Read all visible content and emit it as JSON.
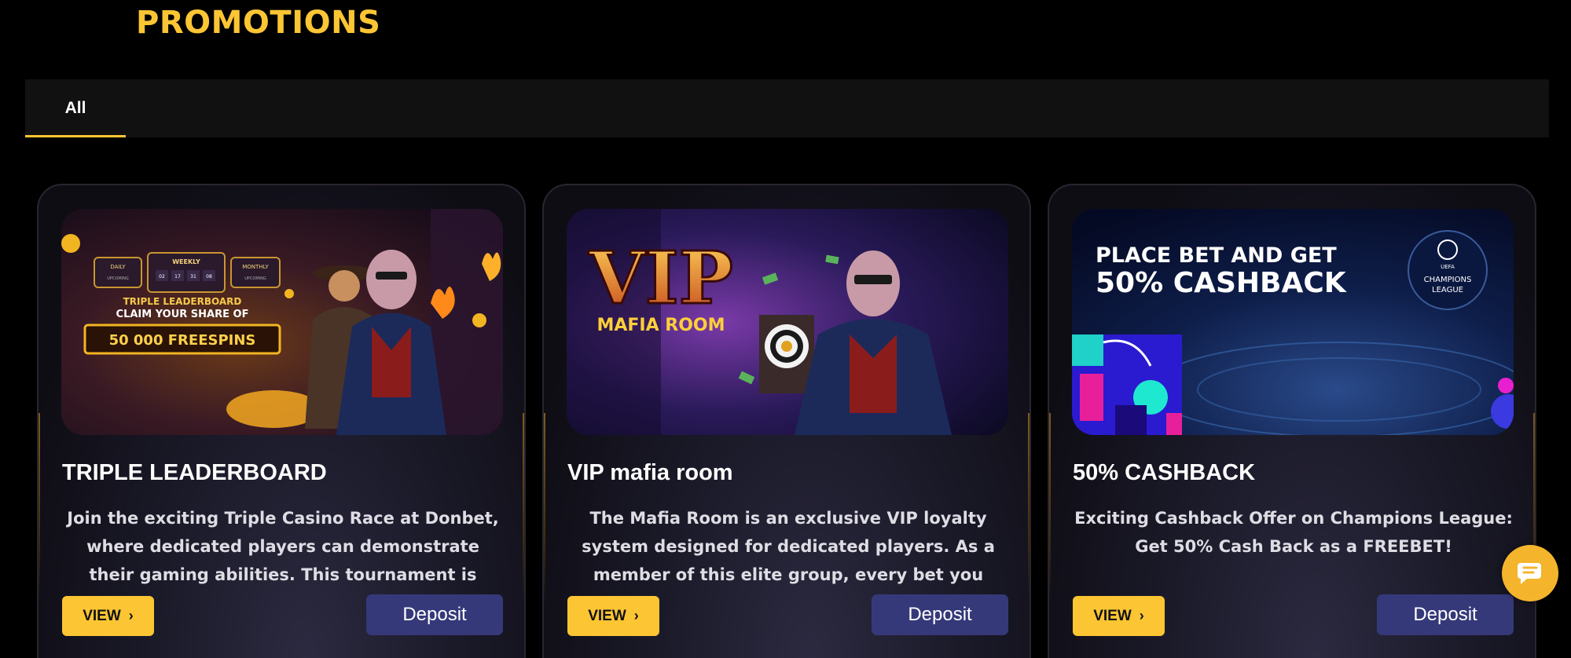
{
  "page": {
    "title": "PROMOTIONS"
  },
  "tabs": [
    {
      "label": "All",
      "active": true
    }
  ],
  "cards": [
    {
      "image": {
        "kind": "triple-leaderboard-banner",
        "daily": "DAILY",
        "weekly": "WEEKLY",
        "monthly": "MONTHLY",
        "upcoming": "UPCOMING",
        "timer": [
          "02",
          "17",
          "31",
          "08"
        ],
        "line1": "TRIPLE LEADERBOARD",
        "line2": "CLAIM YOUR SHARE OF",
        "prize": "50 000 FREESPINS"
      },
      "title": "TRIPLE LEADERBOARD",
      "description": "Join the exciting Triple Casino Race at Donbet, where dedicated players can demonstrate their gaming abilities. This tournament is specifically",
      "view_label": "VIEW",
      "deposit_label": "Deposit"
    },
    {
      "image": {
        "kind": "vip-mafia-banner",
        "vip": "VIP",
        "subtitle": "MAFIA ROOM"
      },
      "title": "VIP mafia room",
      "description": "The Mafia Room is an exclusive VIP loyalty system designed for dedicated players. As a member of this elite group, every bet you place",
      "view_label": "VIEW",
      "deposit_label": "Deposit"
    },
    {
      "image": {
        "kind": "cashback-banner",
        "line1": "PLACE BET AND GET",
        "line2": "50% CASHBACK",
        "badge_top": "UEFA",
        "badge_line1": "CHAMPIONS",
        "badge_line2": "LEAGUE"
      },
      "title": "50% CASHBACK",
      "description": "Exciting Cashback Offer on Champions League: Get 50% Cash Back as a FREEBET!",
      "view_label": "VIEW",
      "deposit_label": "Deposit"
    }
  ],
  "colors": {
    "accent": "#fcc533",
    "deposit": "#35397a",
    "chat": "#f4b52d"
  },
  "icons": {
    "view_chevron": "chevron-right-icon",
    "chat": "chat-bubble-icon"
  }
}
